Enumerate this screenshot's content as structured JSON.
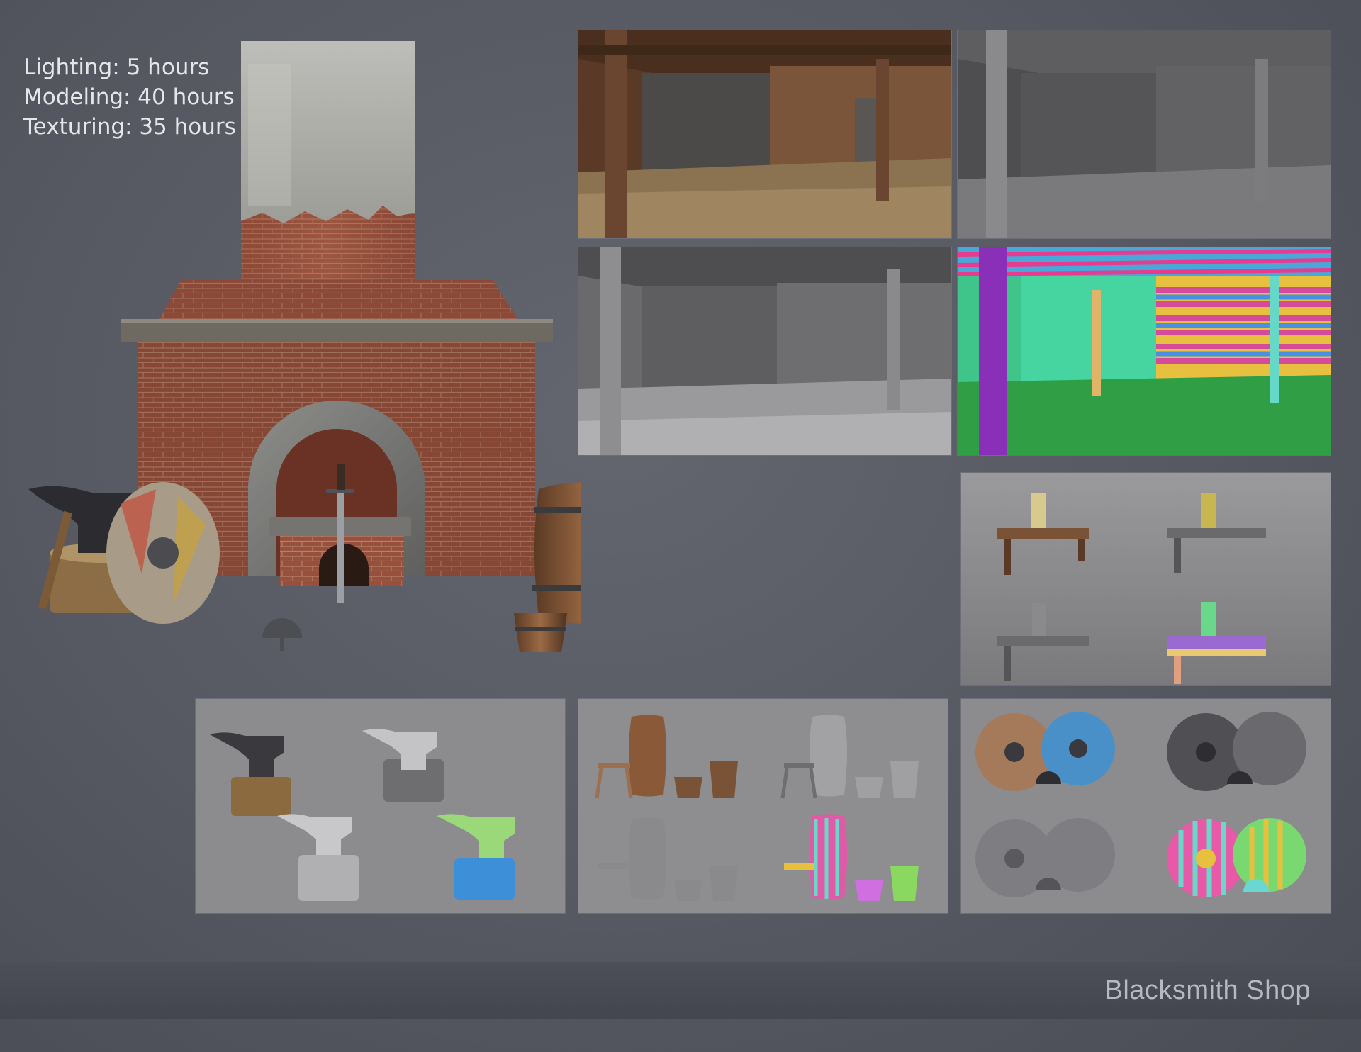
{
  "stats": {
    "lighting": "Lighting: 5 hours",
    "modeling": "Modeling: 40 hours",
    "texturing": "Texturing: 35 hours"
  },
  "footer": {
    "title": "Blacksmith Shop"
  },
  "colors": {
    "background": "#565862",
    "footer_bar": "#484a53",
    "brick": "#9a4e3a",
    "wood": "#7a5236",
    "uv_green": "#2f9e45",
    "uv_purple": "#8a2fb8"
  },
  "icons": [
    "forge-render",
    "interior-textured",
    "interior-clay",
    "interior-uv",
    "candle-table",
    "anvil-set",
    "barrel-set",
    "shield-set"
  ]
}
